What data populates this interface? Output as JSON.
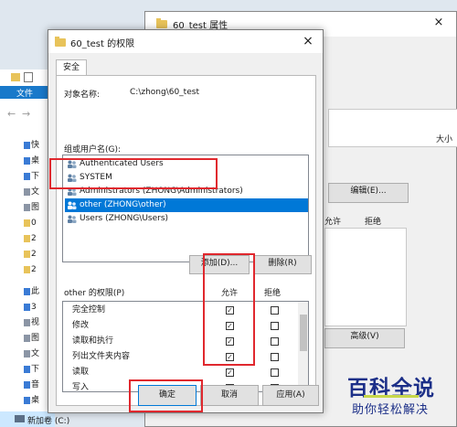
{
  "explorer": {
    "ribbon_tab": "文件",
    "nav_items": [
      {
        "label": "快",
        "icon": "star-icon"
      },
      {
        "label": "桌",
        "icon": "desktop-icon"
      },
      {
        "label": "下",
        "icon": "download-icon"
      },
      {
        "label": "文",
        "icon": "document-icon"
      },
      {
        "label": "图",
        "icon": "picture-icon"
      },
      {
        "label": "0",
        "icon": "folder-icon"
      },
      {
        "label": "2",
        "icon": "folder-icon"
      },
      {
        "label": "2",
        "icon": "folder-icon"
      },
      {
        "label": "2",
        "icon": "folder-icon"
      },
      {
        "label": "此",
        "icon": "computer-icon"
      },
      {
        "label": "3",
        "icon": "cube-icon"
      },
      {
        "label": "视",
        "icon": "video-icon"
      },
      {
        "label": "图",
        "icon": "picture-icon"
      },
      {
        "label": "文",
        "icon": "document-icon"
      },
      {
        "label": "下",
        "icon": "download-icon"
      },
      {
        "label": "音",
        "icon": "music-icon"
      },
      {
        "label": "桌",
        "icon": "desktop-icon"
      }
    ],
    "drive_label": "新加卷 (C:)"
  },
  "props_window": {
    "title": "60_test 属性",
    "size_header": "大小",
    "edit_button": "编辑(E)...",
    "allow_header": "允许",
    "deny_header": "拒绝",
    "advanced_button": "高级(V)"
  },
  "dialog": {
    "title": "60_test 的权限",
    "tab": "安全",
    "object_name_label": "对象名称:",
    "object_name_value": "C:\\zhong\\60_test",
    "group_label": "组或用户名(G):",
    "users": [
      {
        "name": "Authenticated Users",
        "selected": false
      },
      {
        "name": "SYSTEM",
        "selected": false
      },
      {
        "name": "Administrators (ZHONG\\Administrators)",
        "selected": false
      },
      {
        "name": "other (ZHONG\\other)",
        "selected": true
      },
      {
        "name": "Users (ZHONG\\Users)",
        "selected": false
      }
    ],
    "add_button": "添加(D)...",
    "remove_button": "删除(R)",
    "perm_label": "other 的权限(P)",
    "allow_header": "允许",
    "deny_header": "拒绝",
    "permissions": [
      {
        "name": "完全控制",
        "allow": true,
        "deny": false
      },
      {
        "name": "修改",
        "allow": true,
        "deny": false
      },
      {
        "name": "读取和执行",
        "allow": true,
        "deny": false
      },
      {
        "name": "列出文件夹内容",
        "allow": true,
        "deny": false
      },
      {
        "name": "读取",
        "allow": true,
        "deny": false
      },
      {
        "name": "写入",
        "allow": true,
        "deny": false
      }
    ],
    "ok_button": "确定",
    "cancel_button": "取消",
    "apply_button": "应用(A)",
    "close_glyph": "×"
  },
  "watermark": {
    "main": "百科全说",
    "sub": "助你轻松解决"
  },
  "colors": {
    "selection": "#0078d7",
    "highlight": "#e0282e",
    "ribbon": "#1979ca"
  }
}
